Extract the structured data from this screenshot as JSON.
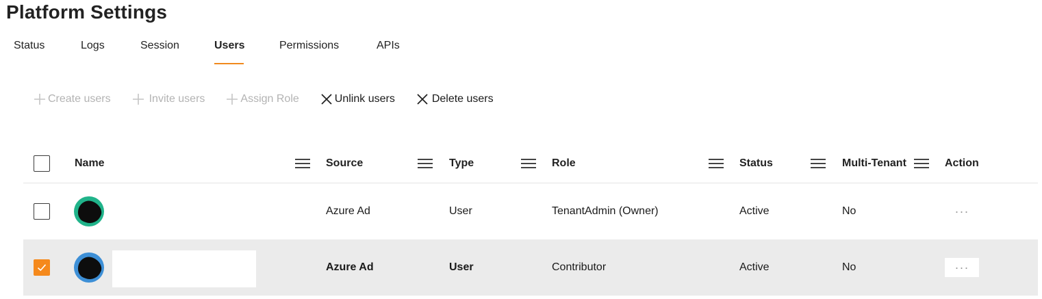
{
  "page": {
    "title": "Platform Settings"
  },
  "tabs": [
    {
      "label": "Status",
      "active": false
    },
    {
      "label": "Logs",
      "active": false
    },
    {
      "label": "Session",
      "active": false
    },
    {
      "label": "Users",
      "active": true
    },
    {
      "label": "Permissions",
      "active": false
    },
    {
      "label": "APIs",
      "active": false
    }
  ],
  "toolbar": {
    "create_users": "Create users",
    "invite_users": "Invite users",
    "assign_role": "Assign Role",
    "unlink_users": "Unlink users",
    "delete_users": "Delete users",
    "disabled_color": "#b3b3b3"
  },
  "table": {
    "columns": {
      "name": "Name",
      "source": "Source",
      "type": "Type",
      "role": "Role",
      "status": "Status",
      "multi_tenant": "Multi-Tenant",
      "action": "Action"
    },
    "rows": [
      {
        "selected": false,
        "avatar_icon": "user-avatar-redacted",
        "avatar_color": "#20b38a",
        "source": "Azure Ad",
        "type": "User",
        "role": "TenantAdmin (Owner)",
        "status": "Active",
        "multi_tenant": "No",
        "action_label": "···"
      },
      {
        "selected": true,
        "avatar_icon": "user-avatar-redacted",
        "avatar_color": "#3d8fd6",
        "source": "Azure Ad",
        "type": "User",
        "role": "Contributor",
        "status": "Active",
        "multi_tenant": "No",
        "action_label": "···"
      }
    ]
  },
  "colors": {
    "accent": "#f0891d",
    "selected_row": "#ebebeb",
    "checkbox_checked": "#f5891c"
  }
}
